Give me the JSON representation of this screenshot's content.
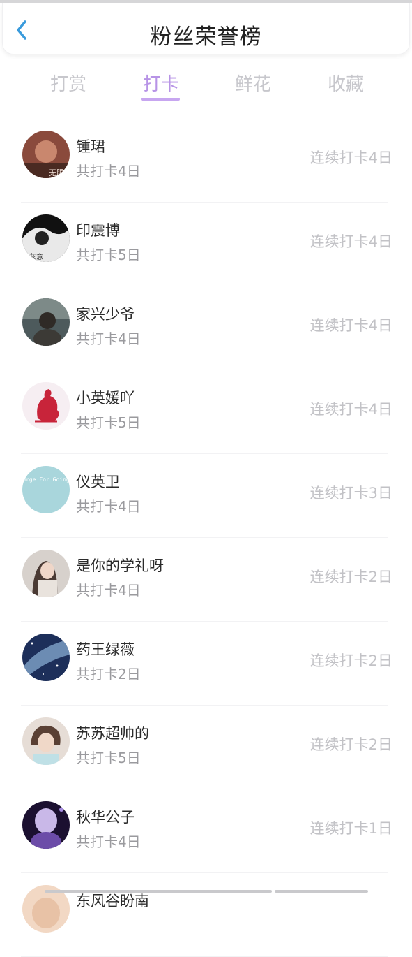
{
  "header": {
    "title": "粉丝荣誉榜"
  },
  "tabs": [
    {
      "label": "打赏"
    },
    {
      "label": "打卡"
    },
    {
      "label": "鲜花"
    },
    {
      "label": "收藏"
    }
  ],
  "active_tab": "打卡",
  "colors": {
    "accent": "#b793e6",
    "muted": "#c7c7cc"
  },
  "rows": [
    {
      "name": "锺珺",
      "total": "共打卡4日",
      "streak": "连续打卡4日",
      "avatar_text": "无限"
    },
    {
      "name": "印震博",
      "total": "共打卡5日",
      "streak": "连续打卡4日",
      "avatar_text": "灰意"
    },
    {
      "name": "家兴少爷",
      "total": "共打卡4日",
      "streak": "连续打卡4日"
    },
    {
      "name": "小英媛吖",
      "total": "共打卡5日",
      "streak": "连续打卡4日"
    },
    {
      "name": "仪英卫",
      "total": "共打卡4日",
      "streak": "连续打卡3日",
      "avatar_text": "Urge For Going"
    },
    {
      "name": "是你的学礼呀",
      "total": "共打卡4日",
      "streak": "连续打卡2日"
    },
    {
      "name": "药王绿薇",
      "total": "共打卡2日",
      "streak": "连续打卡2日"
    },
    {
      "name": "苏苏超帅的",
      "total": "共打卡5日",
      "streak": "连续打卡2日"
    },
    {
      "name": "秋华公子",
      "total": "共打卡4日",
      "streak": "连续打卡1日"
    },
    {
      "name": "东风谷盼南",
      "total": "",
      "streak": ""
    }
  ]
}
